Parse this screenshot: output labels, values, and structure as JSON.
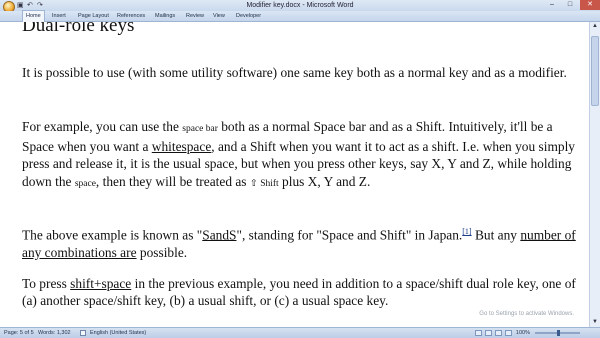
{
  "window": {
    "title": "Modifier key.docx - Microsoft Word",
    "controls": {
      "minimize": "–",
      "maximize": "□",
      "close": "✕"
    }
  },
  "quick_access": {
    "save": "▣",
    "undo": "↶",
    "redo": "↷"
  },
  "ribbon": {
    "tabs": [
      "Home",
      "Insert",
      "Page Layout",
      "References",
      "Mailings",
      "Review",
      "View",
      "Developer"
    ],
    "active": "Home"
  },
  "document": {
    "heading": "Dual-role keys",
    "p1": "It is possible to use (with some utility software) one same key both as a normal key and as a modifier.",
    "p2": {
      "a": "For example, you can use the ",
      "b": "space bar",
      "c": " both as a normal Space bar and as a Shift. Intuitively, it'll be a Space when you want a ",
      "d": "whitespace",
      "e": ", and a Shift when you want it to act as a shift. I.e. when you simply press and release it, it is the usual space, but when you press other keys, say X, Y and Z, while holding down the ",
      "f": "space",
      "g": ", then they will be treated as ",
      "h": "⇧ Shift",
      "i": " plus X, Y and Z."
    },
    "p3": {
      "a": "The above example is known as \"",
      "b": "SandS",
      "c": "\", standing for \"Space and Shift\" in Japan.",
      "d": "[1]",
      "e": " But any ",
      "f": "number of any combinations are",
      "g": " possible."
    },
    "p4": {
      "a": "To press ",
      "b": "shift+space",
      "c": " in the previous example, you need in addition to a space/shift dual role key, one of (a) another space/shift key, (b) a usual shift, or (c) a usual space key."
    }
  },
  "watermark": "Go to Settings to activate Windows.",
  "status_bar": {
    "page": "Page: 5 of 5",
    "words": "Words: 1,302",
    "language": "English (United States)",
    "zoom": "100%"
  }
}
